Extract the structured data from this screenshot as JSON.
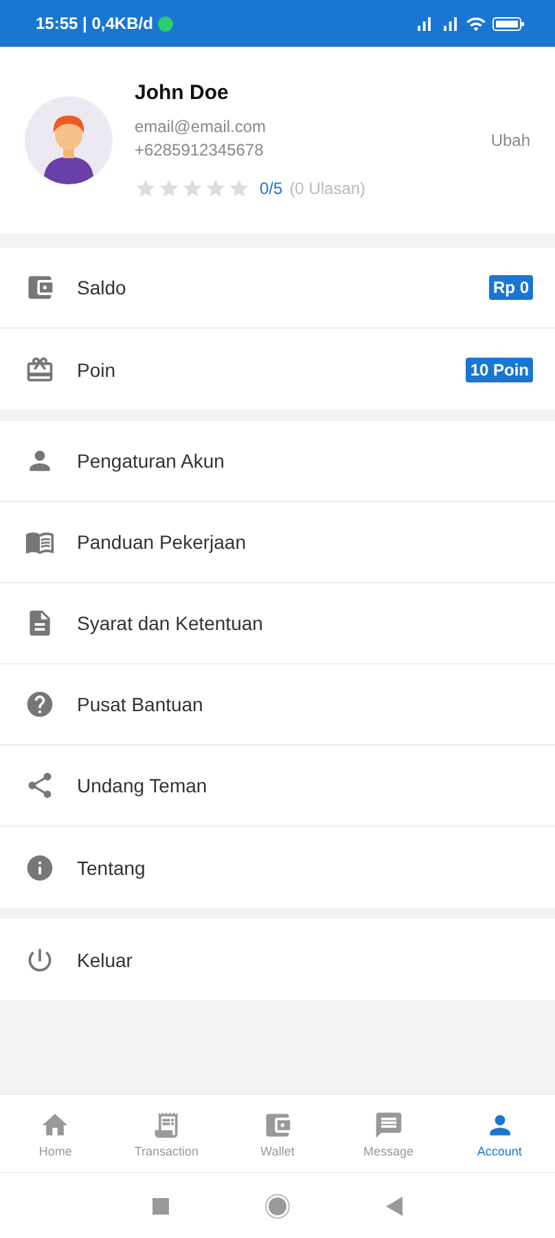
{
  "status_bar": {
    "time": "15:55 | 0,4KB/d"
  },
  "profile": {
    "name": "John Doe",
    "email": "email@email.com",
    "phone": "+6285912345678",
    "edit": "Ubah",
    "stars": 0,
    "rating": "0/5",
    "reviews": "(0 Ulasan)"
  },
  "balances": [
    {
      "kind": "wallet",
      "label": "Saldo",
      "value": "Rp 0"
    },
    {
      "kind": "gift",
      "label": "Poin",
      "value": "10 Poin"
    }
  ],
  "menu": [
    {
      "kind": "person",
      "label": "Pengaturan Akun"
    },
    {
      "kind": "book",
      "label": "Panduan Pekerjaan"
    },
    {
      "kind": "document",
      "label": "Syarat dan Ketentuan"
    },
    {
      "kind": "help",
      "label": "Pusat Bantuan"
    },
    {
      "kind": "share",
      "label": "Undang Teman"
    },
    {
      "kind": "info",
      "label": "Tentang"
    }
  ],
  "logout": {
    "label": "Keluar"
  },
  "bottom_nav": [
    {
      "kind": "home",
      "label": "Home",
      "selected": false
    },
    {
      "kind": "receipt",
      "label": "Transaction",
      "selected": false
    },
    {
      "kind": "wallet",
      "label": "Wallet",
      "selected": false
    },
    {
      "kind": "message",
      "label": "Message",
      "selected": false
    },
    {
      "kind": "person",
      "label": "Account",
      "selected": true
    }
  ]
}
